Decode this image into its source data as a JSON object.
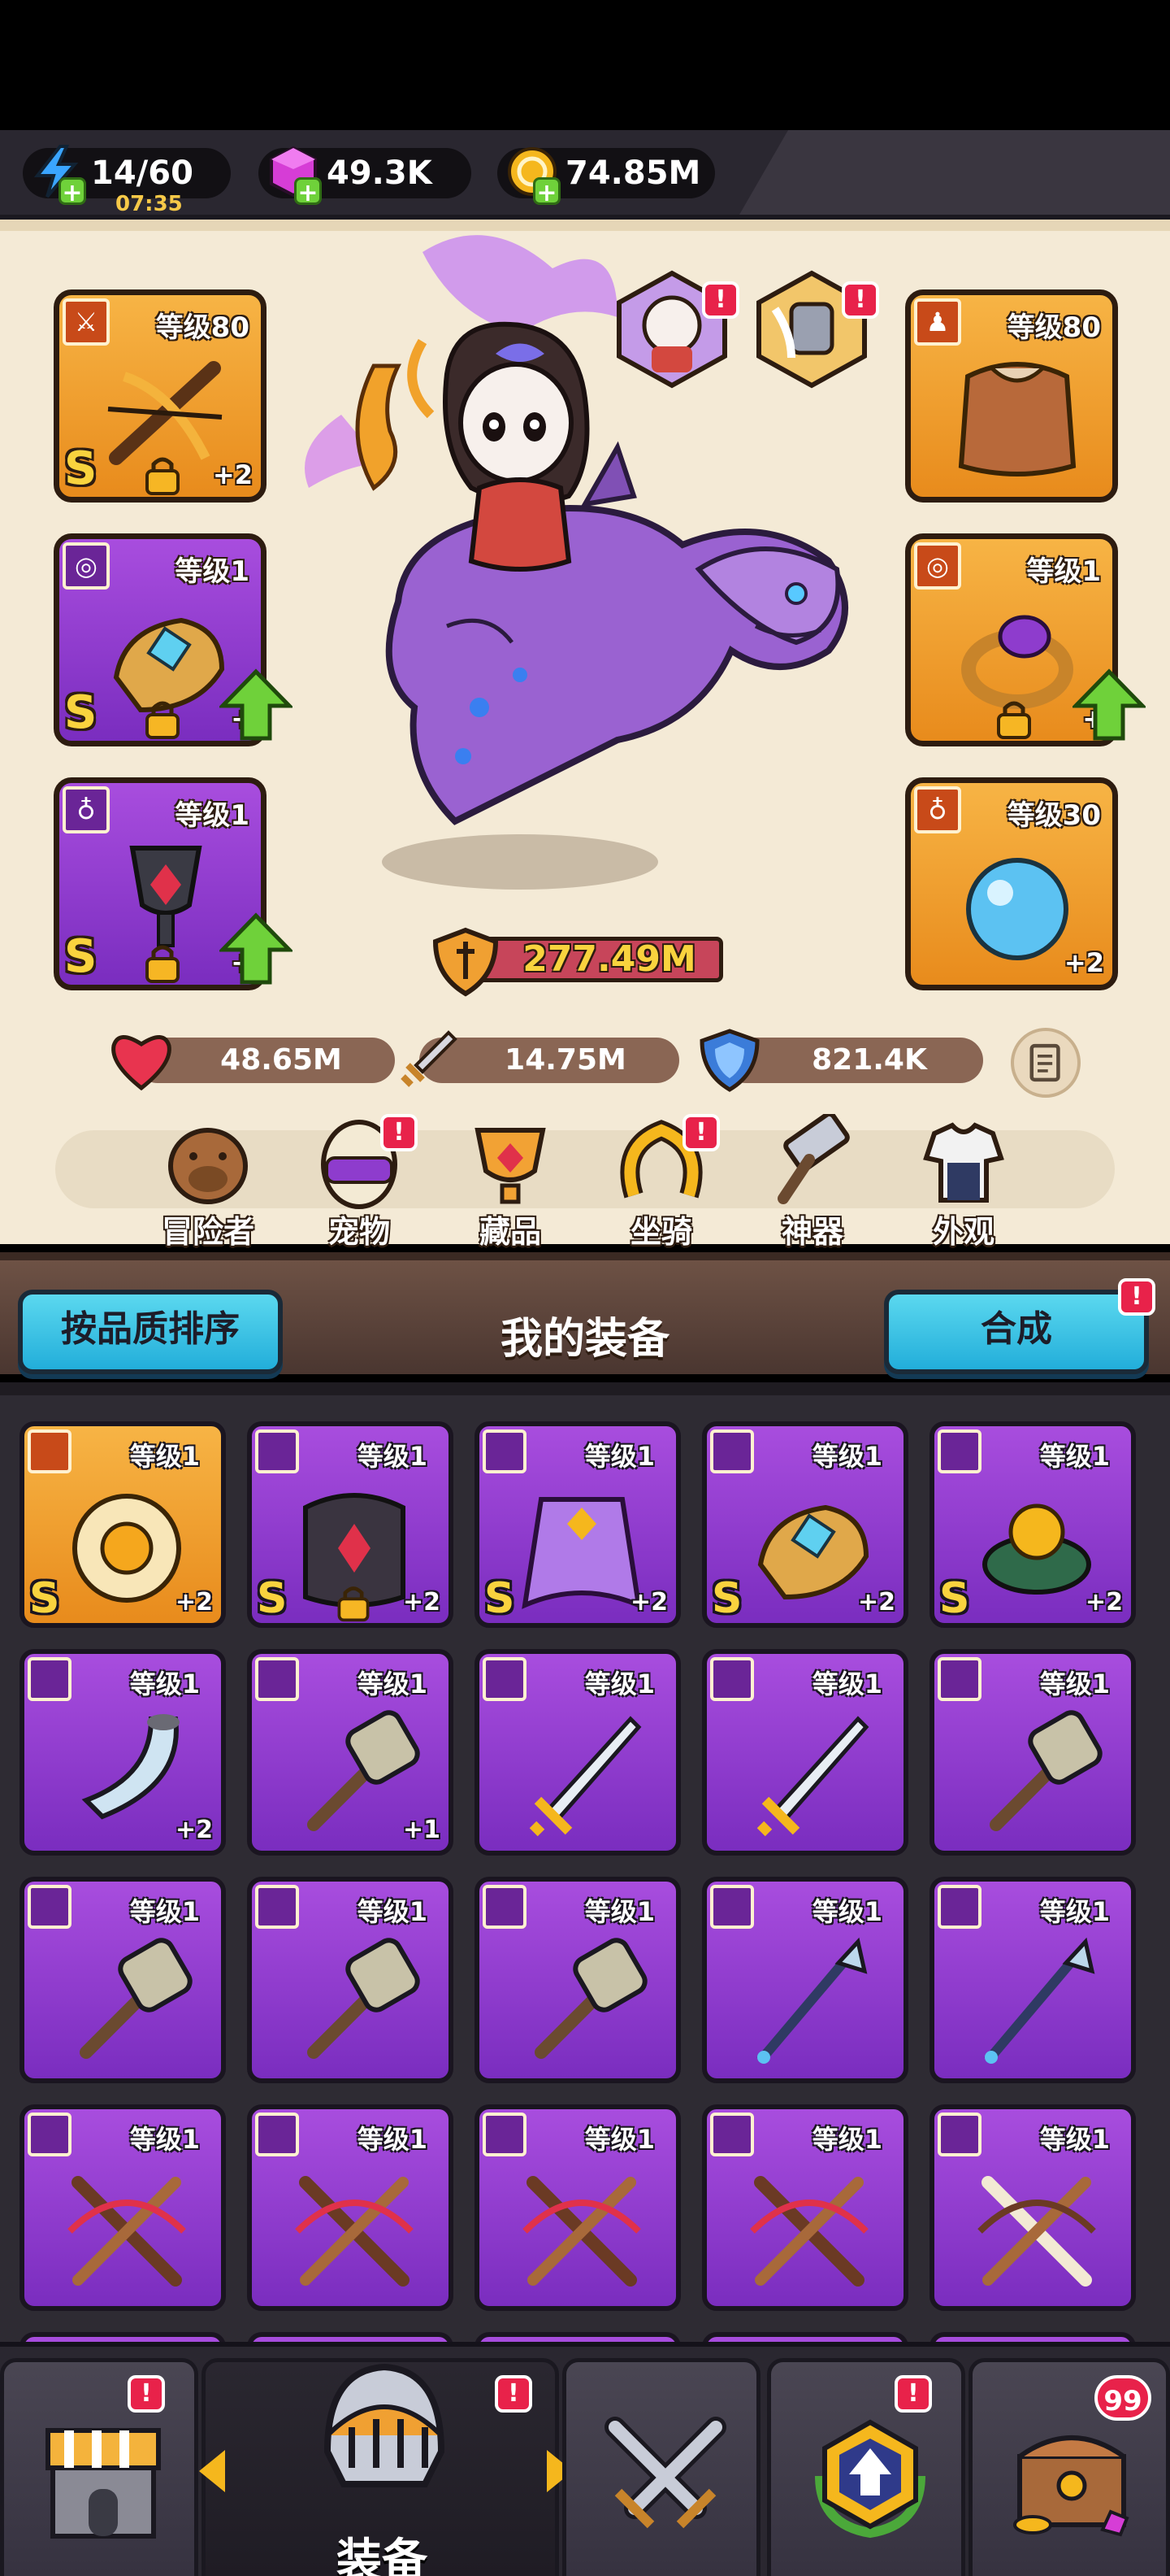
{
  "resources": {
    "energy": {
      "value": "14/60",
      "timer": "07:35",
      "icon": "lightning-icon"
    },
    "gems": {
      "value": "49.3K",
      "icon": "gem-icon"
    },
    "gold": {
      "value": "74.85M",
      "icon": "coin-icon"
    }
  },
  "equipped": {
    "weapon": {
      "level": "等级80",
      "grade": "S",
      "plus": "+2"
    },
    "armor": {
      "level": "等级80"
    },
    "gloves": {
      "level": "等级1",
      "grade": "S",
      "plus": "+"
    },
    "ring": {
      "level": "等级1",
      "grade": "S",
      "plus": "+"
    },
    "necklace": {
      "level": "等级1",
      "grade": "S",
      "plus": "+"
    },
    "amulet": {
      "level": "等级30",
      "plus": "+2"
    }
  },
  "power": "277.49M",
  "stats": {
    "hp": "48.65M",
    "attack": "14.75M",
    "defense": "821.4K"
  },
  "categories": [
    {
      "label": "冒险者",
      "icon": "capybara-icon"
    },
    {
      "label": "宠物",
      "icon": "egg-icon",
      "alert": "!"
    },
    {
      "label": "藏品",
      "icon": "trophy-icon"
    },
    {
      "label": "坐骑",
      "icon": "horseshoe-icon",
      "alert": "!"
    },
    {
      "label": "神器",
      "icon": "hammer-icon"
    },
    {
      "label": "外观",
      "icon": "outfit-icon"
    }
  ],
  "equip_header": {
    "sort_label": "按品质排序",
    "title": "我的装备",
    "merge_label": "合成",
    "merge_alert": "!"
  },
  "inventory": [
    {
      "level": "等级1",
      "grade": "S",
      "plus": "+2",
      "color": "orange",
      "art": "sun-medal"
    },
    {
      "level": "等级1",
      "grade": "S",
      "plus": "+2",
      "color": "purple",
      "art": "dark-armor"
    },
    {
      "level": "等级1",
      "grade": "S",
      "plus": "+2",
      "color": "purple",
      "art": "cape"
    },
    {
      "level": "等级1",
      "grade": "S",
      "plus": "+2",
      "color": "purple",
      "art": "gauntlet"
    },
    {
      "level": "等级1",
      "grade": "S",
      "plus": "+2",
      "color": "purple",
      "art": "orb-ring"
    },
    {
      "level": "等级1",
      "grade": "",
      "plus": "+2",
      "color": "purple",
      "art": "horn"
    },
    {
      "level": "等级1",
      "grade": "",
      "plus": "+1",
      "color": "purple",
      "art": "mace"
    },
    {
      "level": "等级1",
      "grade": "",
      "plus": "",
      "color": "purple",
      "art": "sword"
    },
    {
      "level": "等级1",
      "grade": "",
      "plus": "",
      "color": "purple",
      "art": "sword"
    },
    {
      "level": "等级1",
      "grade": "",
      "plus": "",
      "color": "purple",
      "art": "mace"
    },
    {
      "level": "等级1",
      "grade": "",
      "plus": "",
      "color": "purple",
      "art": "mace"
    },
    {
      "level": "等级1",
      "grade": "",
      "plus": "",
      "color": "purple",
      "art": "mace"
    },
    {
      "level": "等级1",
      "grade": "",
      "plus": "",
      "color": "purple",
      "art": "mace"
    },
    {
      "level": "等级1",
      "grade": "",
      "plus": "",
      "color": "purple",
      "art": "spear"
    },
    {
      "level": "等级1",
      "grade": "",
      "plus": "",
      "color": "purple",
      "art": "spear"
    },
    {
      "level": "等级1",
      "grade": "",
      "plus": "",
      "color": "purple",
      "art": "crossbow"
    },
    {
      "level": "等级1",
      "grade": "",
      "plus": "",
      "color": "purple",
      "art": "crossbow"
    },
    {
      "level": "等级1",
      "grade": "",
      "plus": "",
      "color": "purple",
      "art": "crossbow"
    },
    {
      "level": "等级1",
      "grade": "",
      "plus": "",
      "color": "purple",
      "art": "crossbow"
    },
    {
      "level": "等级1",
      "grade": "",
      "plus": "",
      "color": "purple",
      "art": "bone-crossbow"
    }
  ],
  "bottom_nav": {
    "active_label": "装备",
    "badge_count": "99",
    "alert": "!",
    "tabs": [
      "shop-icon",
      "helmet-icon",
      "crossed-swords-icon",
      "upgrade-shield-icon",
      "treasure-chest-icon"
    ]
  },
  "colors": {
    "orange": "#f0a032",
    "purple": "#8e3ccd",
    "panel": "#f4ead6",
    "alert": "#e8224a"
  }
}
